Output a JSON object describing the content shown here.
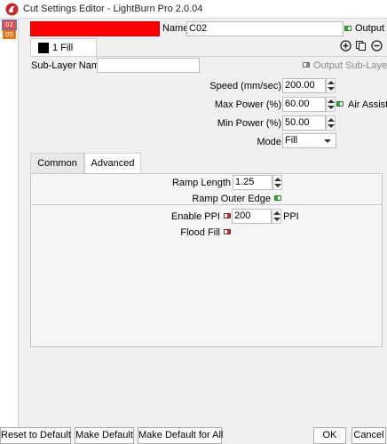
{
  "window": {
    "title": "Cut Settings Editor - LightBurn Pro 2.0.04"
  },
  "layers": [
    {
      "label": "02",
      "color": "#e05050",
      "selected": true
    },
    {
      "label": "05",
      "color": "#e07a1a",
      "selected": false
    }
  ],
  "layer": {
    "color": "#ff0000",
    "name_label": "Name",
    "name_value": "C02",
    "output_label": "Output",
    "output_on": true
  },
  "sublayer": {
    "tab_label": "1 Fill",
    "name_label": "Sub-Layer Name",
    "name_value": "",
    "output_label": "Output Sub-Layer",
    "add_icon": "plus-circle-icon",
    "copy_icon": "copy-icon",
    "remove_icon": "minus-circle-icon"
  },
  "settings": {
    "speed_label": "Speed (mm/sec)",
    "speed_value": "200.00",
    "max_power_label": "Max Power (%)",
    "max_power_value": "60.00",
    "air_assist_label": "Air Assist",
    "air_assist_on": true,
    "min_power_label": "Min Power (%)",
    "min_power_value": "50.00",
    "mode_label": "Mode",
    "mode_value": "Fill"
  },
  "tabs": [
    {
      "label": "Common",
      "active": false
    },
    {
      "label": "Advanced",
      "active": true
    }
  ],
  "advanced": {
    "ramp_length_label": "Ramp Length",
    "ramp_length_value": "1.25",
    "ramp_outer_edge_label": "Ramp Outer Edge",
    "ramp_outer_edge_on": true,
    "enable_ppi_label": "Enable PPI",
    "enable_ppi_on": false,
    "ppi_value": "200",
    "ppi_unit": "PPI",
    "flood_fill_label": "Flood Fill",
    "flood_fill_on": false
  },
  "buttons": {
    "reset": "Reset to Default",
    "make_default": "Make Default",
    "make_default_all": "Make Default for All",
    "ok": "OK",
    "cancel": "Cancel"
  }
}
